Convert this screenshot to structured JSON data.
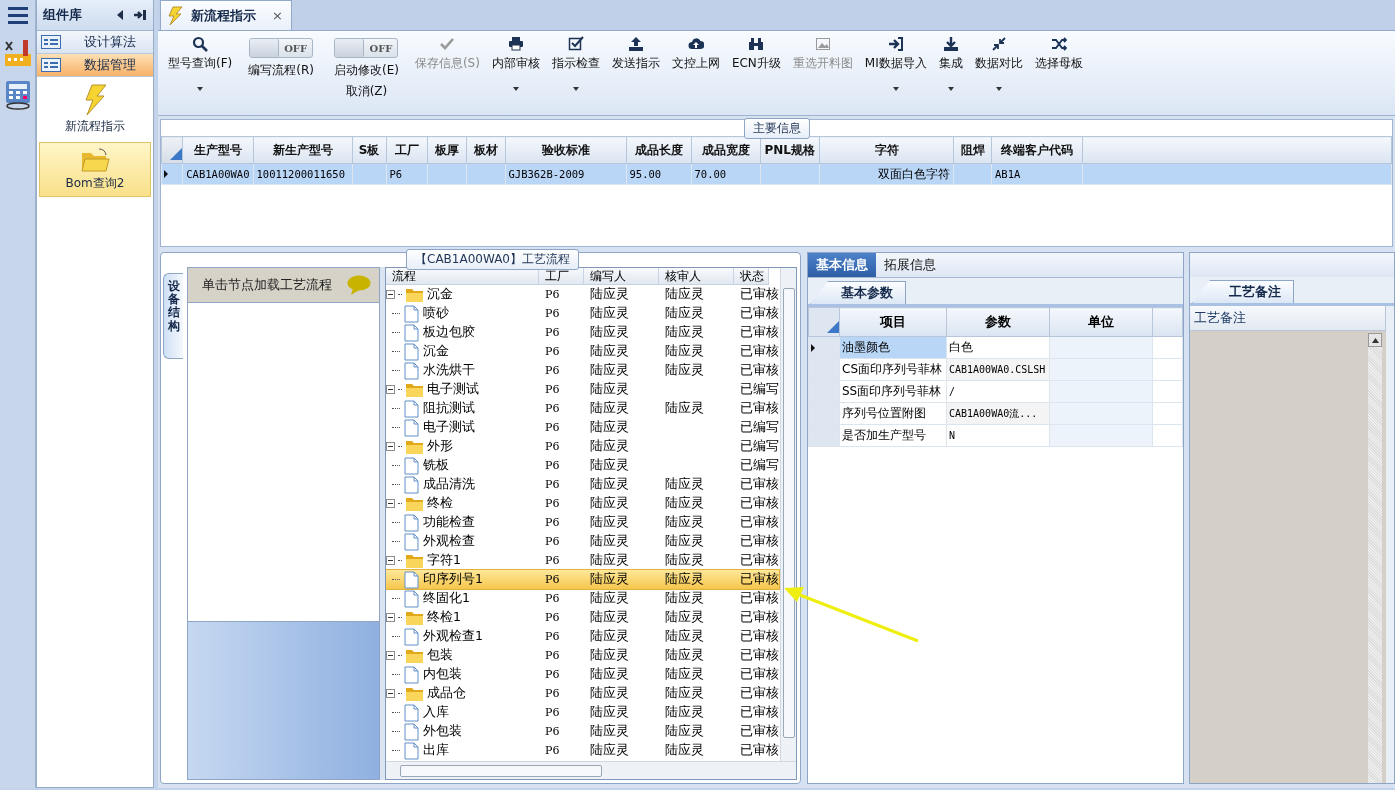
{
  "sidebar": {
    "title": "组件库",
    "groups": [
      {
        "label": "设计算法",
        "selected": false
      },
      {
        "label": "数据管理",
        "selected": true
      }
    ],
    "tiles": [
      {
        "label": "新流程指示",
        "selected": false
      },
      {
        "label": "Bom查询2",
        "selected": true
      }
    ]
  },
  "doc_tab": {
    "title": "新流程指示",
    "close": "×"
  },
  "toolbar": [
    {
      "kind": "button",
      "label": "型号查询(F)",
      "menu": true,
      "disabled": false
    },
    {
      "kind": "toggle",
      "label": "编写流程(R)",
      "state": "OFF",
      "on": false
    },
    {
      "kind": "toggle",
      "label": "启动修改(E)",
      "sublabel": "取消(Z)",
      "state": "OFF",
      "on": false
    },
    {
      "kind": "button",
      "label": "保存信息(S)",
      "menu": false,
      "disabled": true
    },
    {
      "kind": "button",
      "label": "内部审核",
      "menu": true,
      "disabled": false
    },
    {
      "kind": "button",
      "label": "指示检查",
      "menu": true,
      "disabled": false
    },
    {
      "kind": "button",
      "label": "发送指示",
      "menu": false,
      "disabled": false
    },
    {
      "kind": "button",
      "label": "文控上网",
      "menu": false,
      "disabled": false
    },
    {
      "kind": "button",
      "label": "ECN升级",
      "menu": false,
      "disabled": false
    },
    {
      "kind": "button",
      "label": "重选开料图",
      "menu": false,
      "disabled": true
    },
    {
      "kind": "button",
      "label": "MI数据导入",
      "menu": true,
      "disabled": false
    },
    {
      "kind": "button",
      "label": "集成",
      "menu": true,
      "disabled": false
    },
    {
      "kind": "button",
      "label": "数据对比",
      "menu": true,
      "disabled": false
    },
    {
      "kind": "button",
      "label": "选择母板",
      "menu": false,
      "disabled": false
    }
  ],
  "main_info": {
    "legend": "主要信息",
    "columns": [
      "生产型号",
      "新生产型号",
      "S板",
      "工厂",
      "板厚",
      "板材",
      "验收标准",
      "成品长度",
      "成品宽度",
      "PNL规格",
      "字符",
      "阻焊",
      "终端客户代码"
    ],
    "rows": [
      {
        "selected": true,
        "cells": [
          "CAB1A00WA0",
          "10011200011650",
          null,
          "P6",
          null,
          null,
          "GJB362B-2009",
          "95.00",
          "70.00",
          null,
          "双面白色字符",
          null,
          "AB1A"
        ]
      }
    ]
  },
  "flow": {
    "legend": "【CAB1A00WA0】工艺流程",
    "side_tab": "设备结构",
    "hint": "单击节点加载工艺流程",
    "columns": [
      "流程",
      "工厂",
      "编写人",
      "核审人",
      "状态"
    ],
    "tree": [
      {
        "name": "沉金",
        "factory": "P6",
        "writer": "陆应灵",
        "reviewer": "陆应灵",
        "status": "已审核",
        "expanded": true,
        "selected": false,
        "children": [
          {
            "name": "喷砂",
            "factory": "P6",
            "writer": "陆应灵",
            "reviewer": "陆应灵",
            "status": "已审核",
            "selected": false
          },
          {
            "name": "板边包胶",
            "factory": "P6",
            "writer": "陆应灵",
            "reviewer": "陆应灵",
            "status": "已审核",
            "selected": false
          },
          {
            "name": "沉金",
            "factory": "P6",
            "writer": "陆应灵",
            "reviewer": "陆应灵",
            "status": "已审核",
            "selected": false
          },
          {
            "name": "水洗烘干",
            "factory": "P6",
            "writer": "陆应灵",
            "reviewer": "陆应灵",
            "status": "已审核",
            "selected": false
          }
        ]
      },
      {
        "name": "电子测试",
        "factory": "P6",
        "writer": "陆应灵",
        "status": "已编写",
        "expanded": true,
        "selected": false,
        "children": [
          {
            "name": "阻抗测试",
            "factory": "P6",
            "writer": "陆应灵",
            "reviewer": "陆应灵",
            "status": "已审核",
            "selected": false
          },
          {
            "name": "电子测试",
            "factory": "P6",
            "writer": "陆应灵",
            "status": "已编写",
            "selected": false
          }
        ]
      },
      {
        "name": "外形",
        "factory": "P6",
        "writer": "陆应灵",
        "status": "已编写",
        "expanded": true,
        "selected": false,
        "children": [
          {
            "name": "铣板",
            "factory": "P6",
            "writer": "陆应灵",
            "status": "已编写",
            "selected": false
          },
          {
            "name": "成品清洗",
            "factory": "P6",
            "writer": "陆应灵",
            "reviewer": "陆应灵",
            "status": "已审核",
            "selected": false
          }
        ]
      },
      {
        "name": "终检",
        "factory": "P6",
        "writer": "陆应灵",
        "reviewer": "陆应灵",
        "status": "已审核",
        "expanded": true,
        "selected": false,
        "children": [
          {
            "name": "功能检查",
            "factory": "P6",
            "writer": "陆应灵",
            "reviewer": "陆应灵",
            "status": "已审核",
            "selected": false
          },
          {
            "name": "外观检查",
            "factory": "P6",
            "writer": "陆应灵",
            "reviewer": "陆应灵",
            "status": "已审核",
            "selected": false
          }
        ]
      },
      {
        "name": "字符1",
        "factory": "P6",
        "writer": "陆应灵",
        "reviewer": "陆应灵",
        "status": "已审核",
        "expanded": true,
        "selected": false,
        "children": [
          {
            "name": "印序列号1",
            "factory": "P6",
            "writer": "陆应灵",
            "reviewer": "陆应灵",
            "status": "已审核",
            "selected": true
          },
          {
            "name": "终固化1",
            "factory": "P6",
            "writer": "陆应灵",
            "reviewer": "陆应灵",
            "status": "已审核",
            "selected": false
          }
        ]
      },
      {
        "name": "终检1",
        "factory": "P6",
        "writer": "陆应灵",
        "reviewer": "陆应灵",
        "status": "已审核",
        "expanded": true,
        "selected": false,
        "children": [
          {
            "name": "外观检查1",
            "factory": "P6",
            "writer": "陆应灵",
            "reviewer": "陆应灵",
            "status": "已审核",
            "selected": false
          }
        ]
      },
      {
        "name": "包装",
        "factory": "P6",
        "writer": "陆应灵",
        "reviewer": "陆应灵",
        "status": "已审核",
        "expanded": true,
        "selected": false,
        "children": [
          {
            "name": "内包装",
            "factory": "P6",
            "writer": "陆应灵",
            "reviewer": "陆应灵",
            "status": "已审核",
            "selected": false
          }
        ]
      },
      {
        "name": "成品仓",
        "factory": "P6",
        "writer": "陆应灵",
        "reviewer": "陆应灵",
        "status": "已审核",
        "expanded": true,
        "selected": false,
        "children": [
          {
            "name": "入库",
            "factory": "P6",
            "writer": "陆应灵",
            "reviewer": "陆应灵",
            "status": "已审核",
            "selected": false
          },
          {
            "name": "外包装",
            "factory": "P6",
            "writer": "陆应灵",
            "reviewer": "陆应灵",
            "status": "已审核",
            "selected": false
          },
          {
            "name": "出库",
            "factory": "P6",
            "writer": "陆应灵",
            "reviewer": "陆应灵",
            "status": "已审核",
            "selected": false
          }
        ]
      }
    ]
  },
  "info": {
    "tabs": [
      {
        "label": "基本信息",
        "selected": true
      },
      {
        "label": "拓展信息",
        "selected": false
      }
    ],
    "subtab": "基本参数",
    "columns": [
      "项目",
      "参数",
      "单位"
    ],
    "rows": [
      {
        "item": "油墨颜色",
        "value": "白色",
        "selected": true
      },
      {
        "item": "CS面印序列号菲林",
        "value": "CAB1A00WA0.CSLSH",
        "selected": false
      },
      {
        "item": "SS面印序列号菲林",
        "value": "/",
        "selected": false
      },
      {
        "item": "序列号位置附图",
        "value": "CAB1A00WA0流...",
        "selected": false
      },
      {
        "item": "是否加生产型号",
        "value": "N",
        "selected": false
      }
    ]
  },
  "notes": {
    "tab": "工艺备注",
    "column": "工艺备注"
  }
}
